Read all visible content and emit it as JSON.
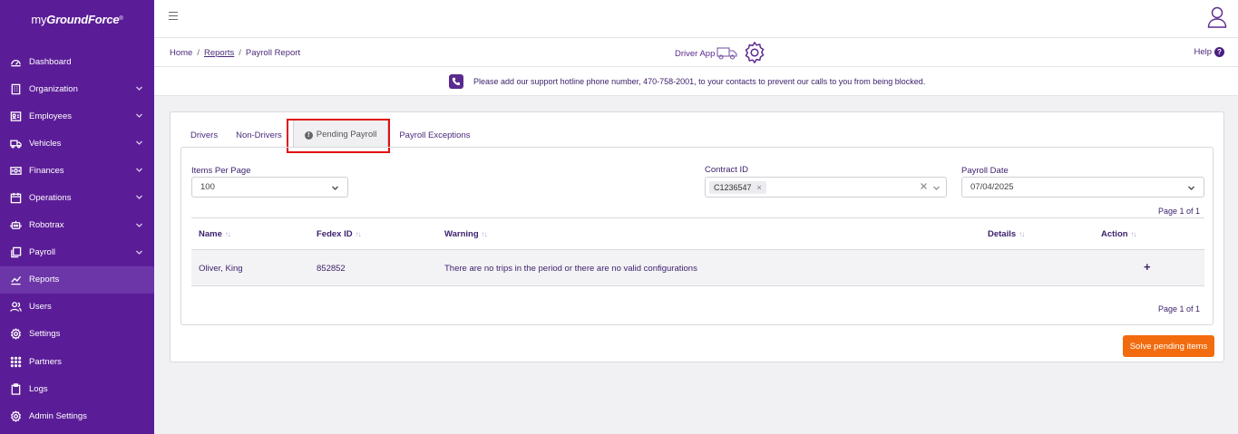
{
  "brand": {
    "prefix": "my",
    "name": "GroundForce",
    "mark": "®"
  },
  "sidebar": {
    "items": [
      {
        "label": "Dashboard",
        "icon": "dashboard-icon",
        "has_chevron": false
      },
      {
        "label": "Organization",
        "icon": "building-icon",
        "has_chevron": true
      },
      {
        "label": "Employees",
        "icon": "id-card-icon",
        "has_chevron": true
      },
      {
        "label": "Vehicles",
        "icon": "truck-icon",
        "has_chevron": true
      },
      {
        "label": "Finances",
        "icon": "money-icon",
        "has_chevron": true
      },
      {
        "label": "Operations",
        "icon": "calendar-icon",
        "has_chevron": true
      },
      {
        "label": "Robotrax",
        "icon": "robot-icon",
        "has_chevron": true
      },
      {
        "label": "Payroll",
        "icon": "copy-icon",
        "has_chevron": true
      },
      {
        "label": "Reports",
        "icon": "chart-line-icon",
        "has_chevron": false,
        "active": true
      },
      {
        "label": "Users",
        "icon": "users-icon",
        "has_chevron": false
      },
      {
        "label": "Settings",
        "icon": "gear-icon",
        "has_chevron": false
      },
      {
        "label": "Partners",
        "icon": "grid-dots-icon",
        "has_chevron": false
      },
      {
        "label": "Logs",
        "icon": "clipboard-icon",
        "has_chevron": false
      },
      {
        "label": "Admin Settings",
        "icon": "gear-icon",
        "has_chevron": false
      }
    ]
  },
  "breadcrumb": {
    "home": "Home",
    "sep": "/",
    "reports": "Reports",
    "current": "Payroll Report"
  },
  "driver_app": {
    "label": "Driver App"
  },
  "help": {
    "label": "Help",
    "q": "?"
  },
  "notice": {
    "text": "Please add our support hotline phone number, 470-758-2001, to your contacts to prevent our calls to you from being blocked."
  },
  "tabs": [
    {
      "label": "Drivers"
    },
    {
      "label": "Non-Drivers"
    },
    {
      "label": "Pending Payroll",
      "active": true
    },
    {
      "label": "Payroll Exceptions"
    }
  ],
  "filters": {
    "items_per_page": {
      "label": "Items Per Page",
      "value": "100"
    },
    "contract_id": {
      "label": "Contract ID",
      "chip": "C1236547",
      "chip_x": "×"
    },
    "payroll_date": {
      "label": "Payroll Date",
      "value": "07/04/2025"
    }
  },
  "pagination": {
    "top": "Page 1 of 1",
    "bottom": "Page 1 of 1"
  },
  "table": {
    "headers": {
      "name": "Name",
      "fedex_id": "Fedex ID",
      "warning": "Warning",
      "details": "Details",
      "action": "Action"
    },
    "sort_glyph": "↑↓",
    "rows": [
      {
        "name": "Oliver, King",
        "fedex_id": "852852",
        "warning": "There are no trips in the period or there are no valid configurations",
        "details": "",
        "action": "+"
      }
    ]
  },
  "actions": {
    "solve": "Solve pending items"
  },
  "colors": {
    "sidebar": "#5b1d97",
    "accent": "#f26c0f",
    "highlight": "#e01010"
  }
}
